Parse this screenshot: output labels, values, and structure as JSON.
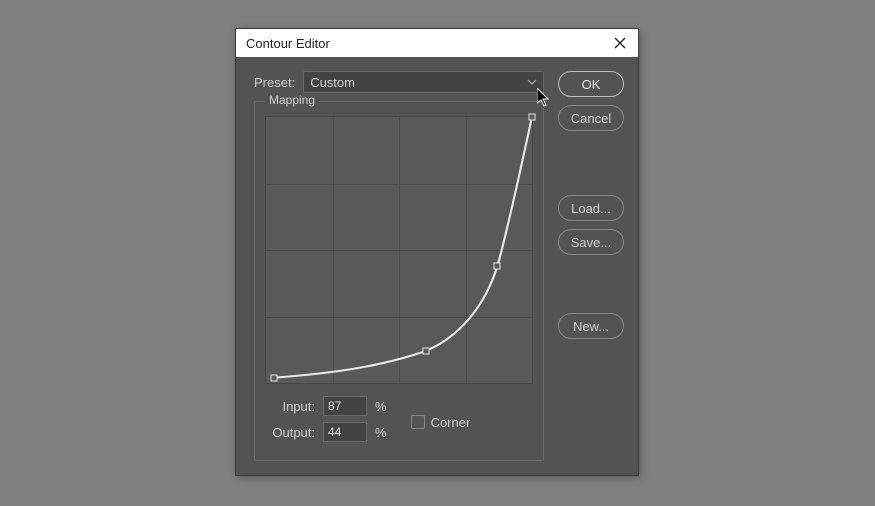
{
  "dialog": {
    "title": "Contour Editor",
    "preset_label": "Preset:",
    "preset_value": "Custom",
    "mapping_label": "Mapping",
    "input_label": "Input:",
    "input_value": "87",
    "output_label": "Output:",
    "output_value": "44",
    "percent": "%",
    "corner_label": "Corner"
  },
  "buttons": {
    "ok": "OK",
    "cancel": "Cancel",
    "load": "Load...",
    "save": "Save...",
    "new": "New..."
  },
  "chart_data": {
    "type": "line",
    "title": "Mapping",
    "xlabel": "Input",
    "ylabel": "Output",
    "xlim": [
      0,
      100
    ],
    "ylim": [
      0,
      100
    ],
    "points": [
      {
        "x": 3,
        "y": 2
      },
      {
        "x": 60,
        "y": 12
      },
      {
        "x": 87,
        "y": 44
      },
      {
        "x": 100,
        "y": 100
      }
    ],
    "grid": true,
    "grid_divisions": 4
  }
}
